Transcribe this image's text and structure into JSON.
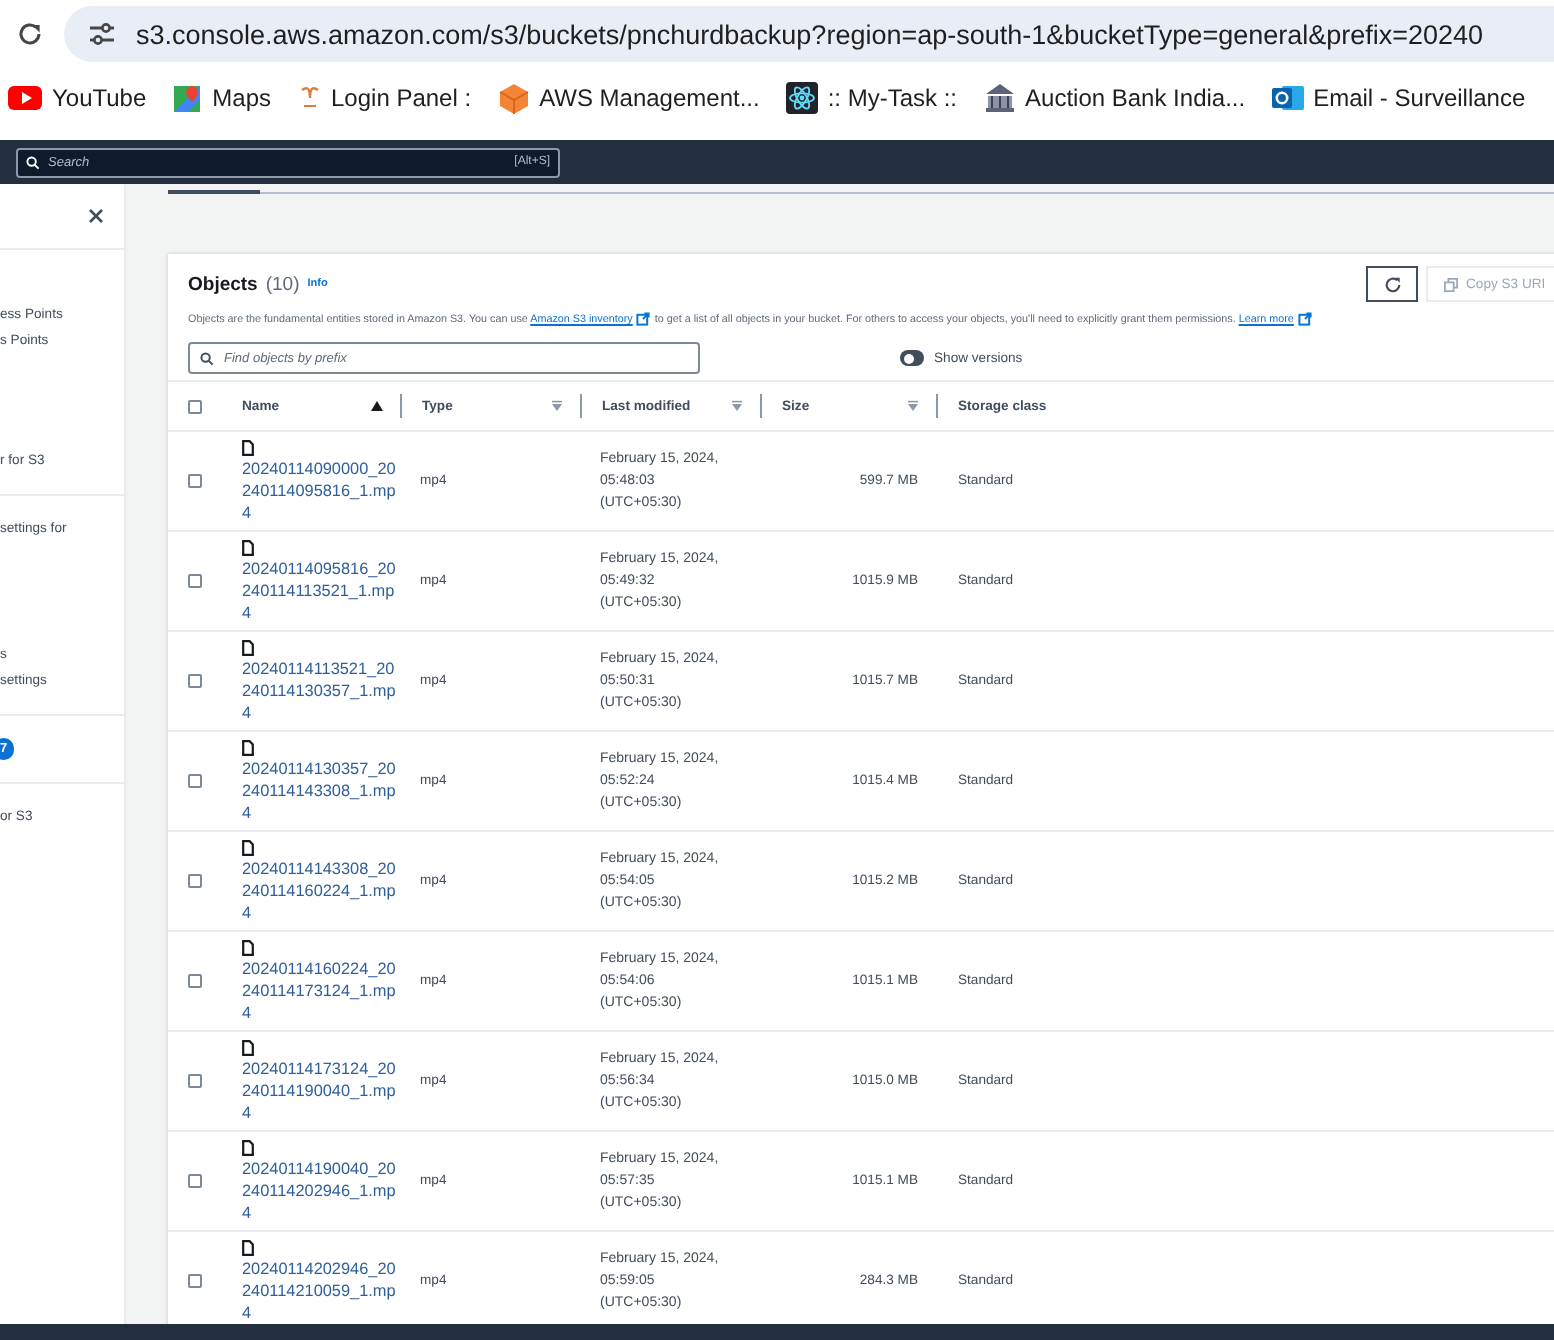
{
  "browser": {
    "url": "s3.console.aws.amazon.com/s3/buckets/pnchurdbackup?region=ap-south-1&bucketType=general&prefix=20240",
    "bookmarks": [
      {
        "kind": "youtube",
        "label": "YouTube"
      },
      {
        "kind": "maps",
        "label": "Maps"
      },
      {
        "kind": "login",
        "label": "Login Panel :"
      },
      {
        "kind": "aws",
        "label": "AWS Management..."
      },
      {
        "kind": "atom",
        "label": ":: My-Task ::"
      },
      {
        "kind": "bank",
        "label": "Auction Bank India..."
      },
      {
        "kind": "mail",
        "label": "Email - Surveillance"
      }
    ]
  },
  "top_nav": {
    "search": {
      "placeholder": "Search",
      "shortcut": "[Alt+S]"
    }
  },
  "sidebar": {
    "sections": [
      {
        "items": [
          {
            "kind": "link",
            "label": "ess Points"
          },
          {
            "kind": "link",
            "label": "s Points"
          },
          {
            "kind": "link",
            "label": "r for S3"
          }
        ]
      },
      {
        "items": [
          {
            "kind": "link",
            "label": "settings for"
          },
          {
            "kind": "link",
            "label": "s"
          },
          {
            "kind": "link",
            "label": "settings"
          }
        ]
      },
      {
        "items": [
          {
            "kind": "badge",
            "label": "7"
          }
        ]
      },
      {
        "items": [
          {
            "kind": "link",
            "label": "or S3"
          }
        ]
      }
    ]
  },
  "objects": {
    "title": "Objects",
    "count": "(10)",
    "info": "Info",
    "description": {
      "before": "Objects are the fundamental entities stored in Amazon S3. You can use",
      "link": "Amazon S3 inventory",
      "after": "to get a list of all objects in your bucket. For others to access your objects, you'll need to explicitly grant them permissions.",
      "learn_more": "Learn more"
    },
    "copy_button": {
      "label": "Copy S3 URI",
      "disabled": true
    },
    "search": {
      "placeholder": "Find objects by prefix"
    },
    "show_versions": {
      "label": "Show versions",
      "on": false
    }
  },
  "table": {
    "select_all": false,
    "columns": [
      {
        "label": "Name",
        "sortable": true,
        "sorted": true
      },
      {
        "label": "Type",
        "sortable": true,
        "sorted": false
      },
      {
        "label": "Last modified",
        "sortable": true,
        "sorted": false
      },
      {
        "label": "Size",
        "sortable": true,
        "sorted": false
      },
      {
        "label": "Storage class"
      }
    ],
    "rows": [
      {
        "selected": false,
        "name": "20240114090000_20240114095816_1.mp4",
        "type": "mp4",
        "last_modified": "February 15, 2024, 05:48:03 (UTC+05:30)",
        "size": "599.7 MB",
        "storage_class": "Standard"
      },
      {
        "selected": false,
        "name": "20240114095816_20240114113521_1.mp4",
        "type": "mp4",
        "last_modified": "February 15, 2024, 05:49:32 (UTC+05:30)",
        "size": "1015.9 MB",
        "storage_class": "Standard"
      },
      {
        "selected": false,
        "name": "20240114113521_20240114130357_1.mp4",
        "type": "mp4",
        "last_modified": "February 15, 2024, 05:50:31 (UTC+05:30)",
        "size": "1015.7 MB",
        "storage_class": "Standard"
      },
      {
        "selected": false,
        "name": "20240114130357_20240114143308_1.mp4",
        "type": "mp4",
        "last_modified": "February 15, 2024, 05:52:24 (UTC+05:30)",
        "size": "1015.4 MB",
        "storage_class": "Standard"
      },
      {
        "selected": false,
        "name": "20240114143308_20240114160224_1.mp4",
        "type": "mp4",
        "last_modified": "February 15, 2024, 05:54:05 (UTC+05:30)",
        "size": "1015.2 MB",
        "storage_class": "Standard"
      },
      {
        "selected": false,
        "name": "20240114160224_20240114173124_1.mp4",
        "type": "mp4",
        "last_modified": "February 15, 2024, 05:54:06 (UTC+05:30)",
        "size": "1015.1 MB",
        "storage_class": "Standard"
      },
      {
        "selected": false,
        "name": "20240114173124_20240114190040_1.mp4",
        "type": "mp4",
        "last_modified": "February 15, 2024, 05:56:34 (UTC+05:30)",
        "size": "1015.0 MB",
        "storage_class": "Standard"
      },
      {
        "selected": false,
        "name": "20240114190040_20240114202946_1.mp4",
        "type": "mp4",
        "last_modified": "February 15, 2024, 05:57:35 (UTC+05:30)",
        "size": "1015.1 MB",
        "storage_class": "Standard"
      },
      {
        "selected": false,
        "name": "20240114202946_20240114210059_1.mp4",
        "type": "mp4",
        "last_modified": "February 15, 2024, 05:59:05 (UTC+05:30)",
        "size": "284.3 MB",
        "storage_class": "Standard"
      }
    ]
  }
}
